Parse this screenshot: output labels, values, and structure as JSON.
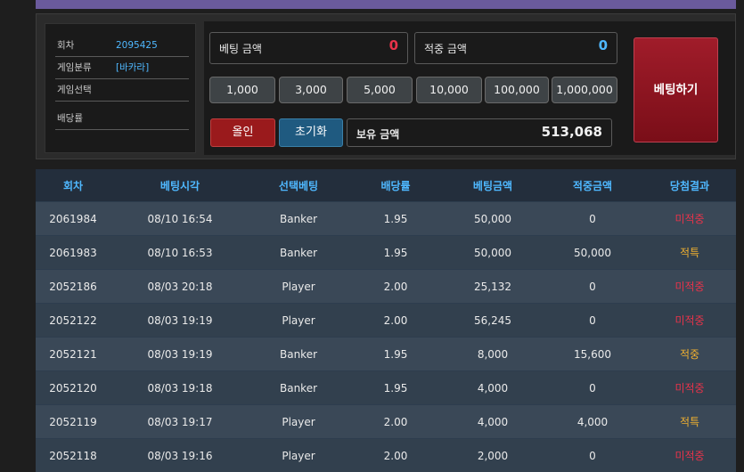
{
  "info": {
    "round_label": "회차",
    "round_value": "2095425",
    "category_label": "게임분류",
    "category_value": "[바카라]",
    "select_label": "게임선택",
    "select_value": "",
    "odds_label": "배당률",
    "odds_value": ""
  },
  "bet": {
    "amount_label": "베팅 금액",
    "amount_value": "0",
    "win_label": "적중 금액",
    "win_value": "0",
    "chips": [
      "1,000",
      "3,000",
      "5,000",
      "10,000",
      "100,000",
      "1,000,000"
    ],
    "allin_label": "올인",
    "reset_label": "초기화",
    "balance_label": "보유 금액",
    "balance_value": "513,068",
    "submit_label": "베팅하기"
  },
  "table": {
    "headers": [
      "회차",
      "베팅시각",
      "선택베팅",
      "배당률",
      "베팅금액",
      "적중금액",
      "당첨결과"
    ],
    "rows": [
      [
        "2061984",
        "08/10 16:54",
        "Banker",
        "1.95",
        "50,000",
        "0",
        "미적중"
      ],
      [
        "2061983",
        "08/10 16:53",
        "Banker",
        "1.95",
        "50,000",
        "50,000",
        "적특"
      ],
      [
        "2052186",
        "08/03 20:18",
        "Player",
        "2.00",
        "25,132",
        "0",
        "미적중"
      ],
      [
        "2052122",
        "08/03 19:19",
        "Player",
        "2.00",
        "56,245",
        "0",
        "미적중"
      ],
      [
        "2052121",
        "08/03 19:19",
        "Banker",
        "1.95",
        "8,000",
        "15,600",
        "적중"
      ],
      [
        "2052120",
        "08/03 19:18",
        "Banker",
        "1.95",
        "4,000",
        "0",
        "미적중"
      ],
      [
        "2052119",
        "08/03 19:17",
        "Player",
        "2.00",
        "4,000",
        "4,000",
        "적특"
      ],
      [
        "2052118",
        "08/03 19:16",
        "Player",
        "2.00",
        "2,000",
        "0",
        "미적중"
      ]
    ]
  },
  "colors": {
    "accent": "#4fb8ff",
    "lose": "#e8334a",
    "win": "#f0b030",
    "bet_button": "#8a1420"
  }
}
